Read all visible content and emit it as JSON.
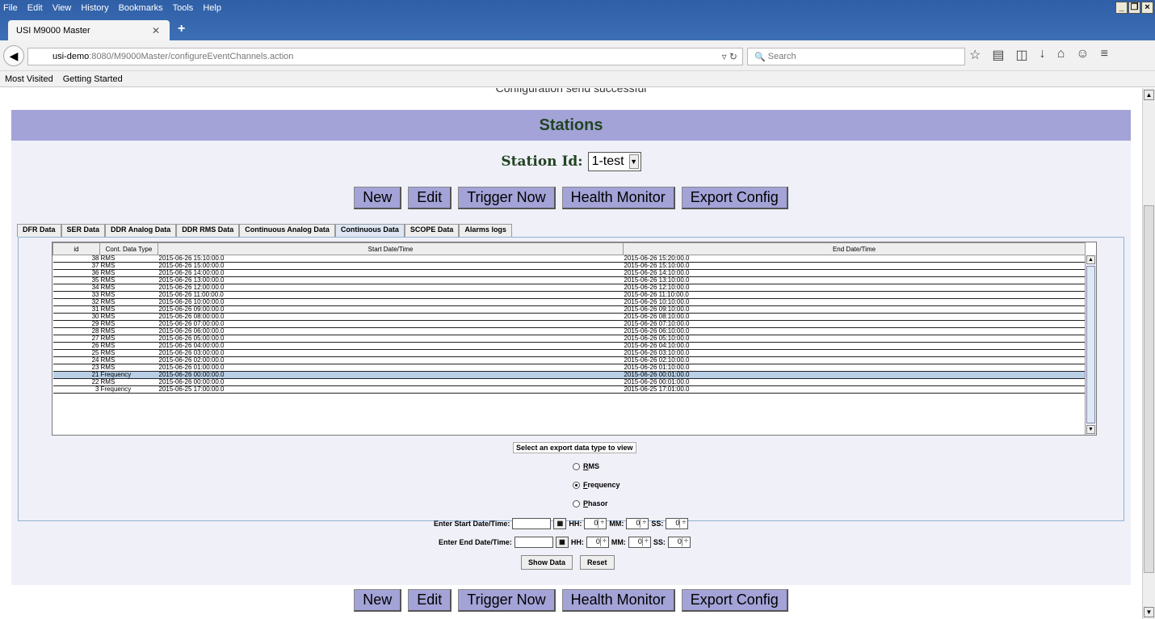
{
  "browser": {
    "menu": [
      "File",
      "Edit",
      "View",
      "History",
      "Bookmarks",
      "Tools",
      "Help"
    ],
    "tab_title": "USI M9000 Master",
    "url_host": "usi-demo",
    "url_rest": ":8080/M9000Master/configureEventChannels.action",
    "search_placeholder": "Search",
    "bookmarks": [
      "Most Visited",
      "Getting Started"
    ]
  },
  "page": {
    "message": "Configuration send successful",
    "section_title": "Stations",
    "station_label": "Station Id:",
    "station_value": "1-test",
    "buttons": [
      "New",
      "Edit",
      "Trigger Now",
      "Health Monitor",
      "Export Config"
    ],
    "tabs": [
      "DFR Data",
      "SER Data",
      "DDR Analog Data",
      "DDR RMS Data",
      "Continuous Analog Data",
      "Continuous Data",
      "SCOPE Data",
      "Alarms logs"
    ],
    "active_tab": "Continuous Data",
    "table": {
      "columns": [
        "id",
        "Cont. Data Type",
        "Start Date/Time",
        "End Date/Time"
      ],
      "rows": [
        [
          "38",
          "RMS",
          "2015-06-26 15:10:00.0",
          "2015-06-26 15:20:00.0"
        ],
        [
          "37",
          "RMS",
          "2015-06-26 15:00:00.0",
          "2015-06-26 15:10:00.0"
        ],
        [
          "36",
          "RMS",
          "2015-06-26 14:00:00.0",
          "2015-06-26 14:10:00.0"
        ],
        [
          "35",
          "RMS",
          "2015-06-26 13:00:00.0",
          "2015-06-26 13:10:00.0"
        ],
        [
          "34",
          "RMS",
          "2015-06-26 12:00:00.0",
          "2015-06-26 12:10:00.0"
        ],
        [
          "33",
          "RMS",
          "2015-06-26 11:00:00.0",
          "2015-06-26 11:10:00.0"
        ],
        [
          "32",
          "RMS",
          "2015-06-26 10:00:00.0",
          "2015-06-26 10:10:00.0"
        ],
        [
          "31",
          "RMS",
          "2015-06-26 09:00:00.0",
          "2015-06-26 09:10:00.0"
        ],
        [
          "30",
          "RMS",
          "2015-06-26 08:00:00.0",
          "2015-06-26 08:10:00.0"
        ],
        [
          "29",
          "RMS",
          "2015-06-26 07:00:00.0",
          "2015-06-26 07:10:00.0"
        ],
        [
          "28",
          "RMS",
          "2015-06-26 06:00:00.0",
          "2015-06-26 06:10:00.0"
        ],
        [
          "27",
          "RMS",
          "2015-06-26 05:00:00.0",
          "2015-06-26 05:10:00.0"
        ],
        [
          "26",
          "RMS",
          "2015-06-26 04:00:00.0",
          "2015-06-26 04:10:00.0"
        ],
        [
          "25",
          "RMS",
          "2015-06-26 03:00:00.0",
          "2015-06-26 03:10:00.0"
        ],
        [
          "24",
          "RMS",
          "2015-06-26 02:00:00.0",
          "2015-06-26 02:10:00.0"
        ],
        [
          "23",
          "RMS",
          "2015-06-26 01:00:00.0",
          "2015-06-26 01:10:00.0"
        ],
        [
          "21",
          "Frequency",
          "2015-06-26 00:00:00.0",
          "2015-06-26 00:01:00.0"
        ],
        [
          "22",
          "RMS",
          "2015-06-26 00:00:00.0",
          "2015-06-26 00:01:00.0"
        ],
        [
          "3",
          "Frequency",
          "2015-06-25 17:00:00.0",
          "2015-06-25 17:01:00.0"
        ]
      ],
      "selected_row_id": "21"
    },
    "export_label": "Select an export data type to view",
    "radio_options": [
      "RMS",
      "Frequency",
      "Phasor"
    ],
    "radio_selected": "Frequency",
    "start_label": "Enter Start Date/Time:",
    "end_label": "Enter End Date/Time:",
    "hh_label": "HH:",
    "mm_label": "MM:",
    "ss_label": "SS:",
    "spin_value": "0",
    "show_data": "Show Data",
    "reset": "Reset"
  }
}
